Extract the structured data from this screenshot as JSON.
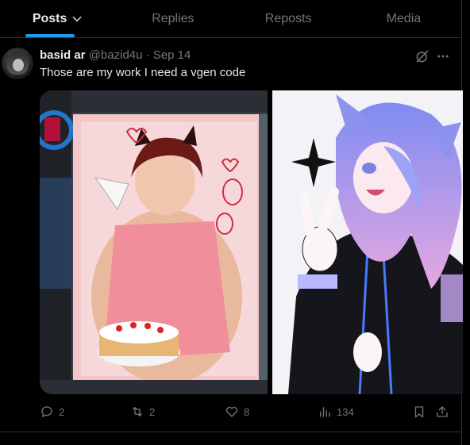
{
  "tabs": [
    {
      "label": "Posts"
    },
    {
      "label": "Replies"
    },
    {
      "label": "Reposts"
    },
    {
      "label": "Media"
    }
  ],
  "post": {
    "author_name": "basid ar",
    "handle": "@bazid4u",
    "separator": "·",
    "date": "Sep 14",
    "text": "Those are my work I need a vgen code",
    "stats": {
      "replies": "2",
      "reposts": "2",
      "likes": "8",
      "views": "134"
    }
  },
  "colors": {
    "accent": "#1d9bf0",
    "muted": "#71767b",
    "divider": "#2f3336"
  }
}
